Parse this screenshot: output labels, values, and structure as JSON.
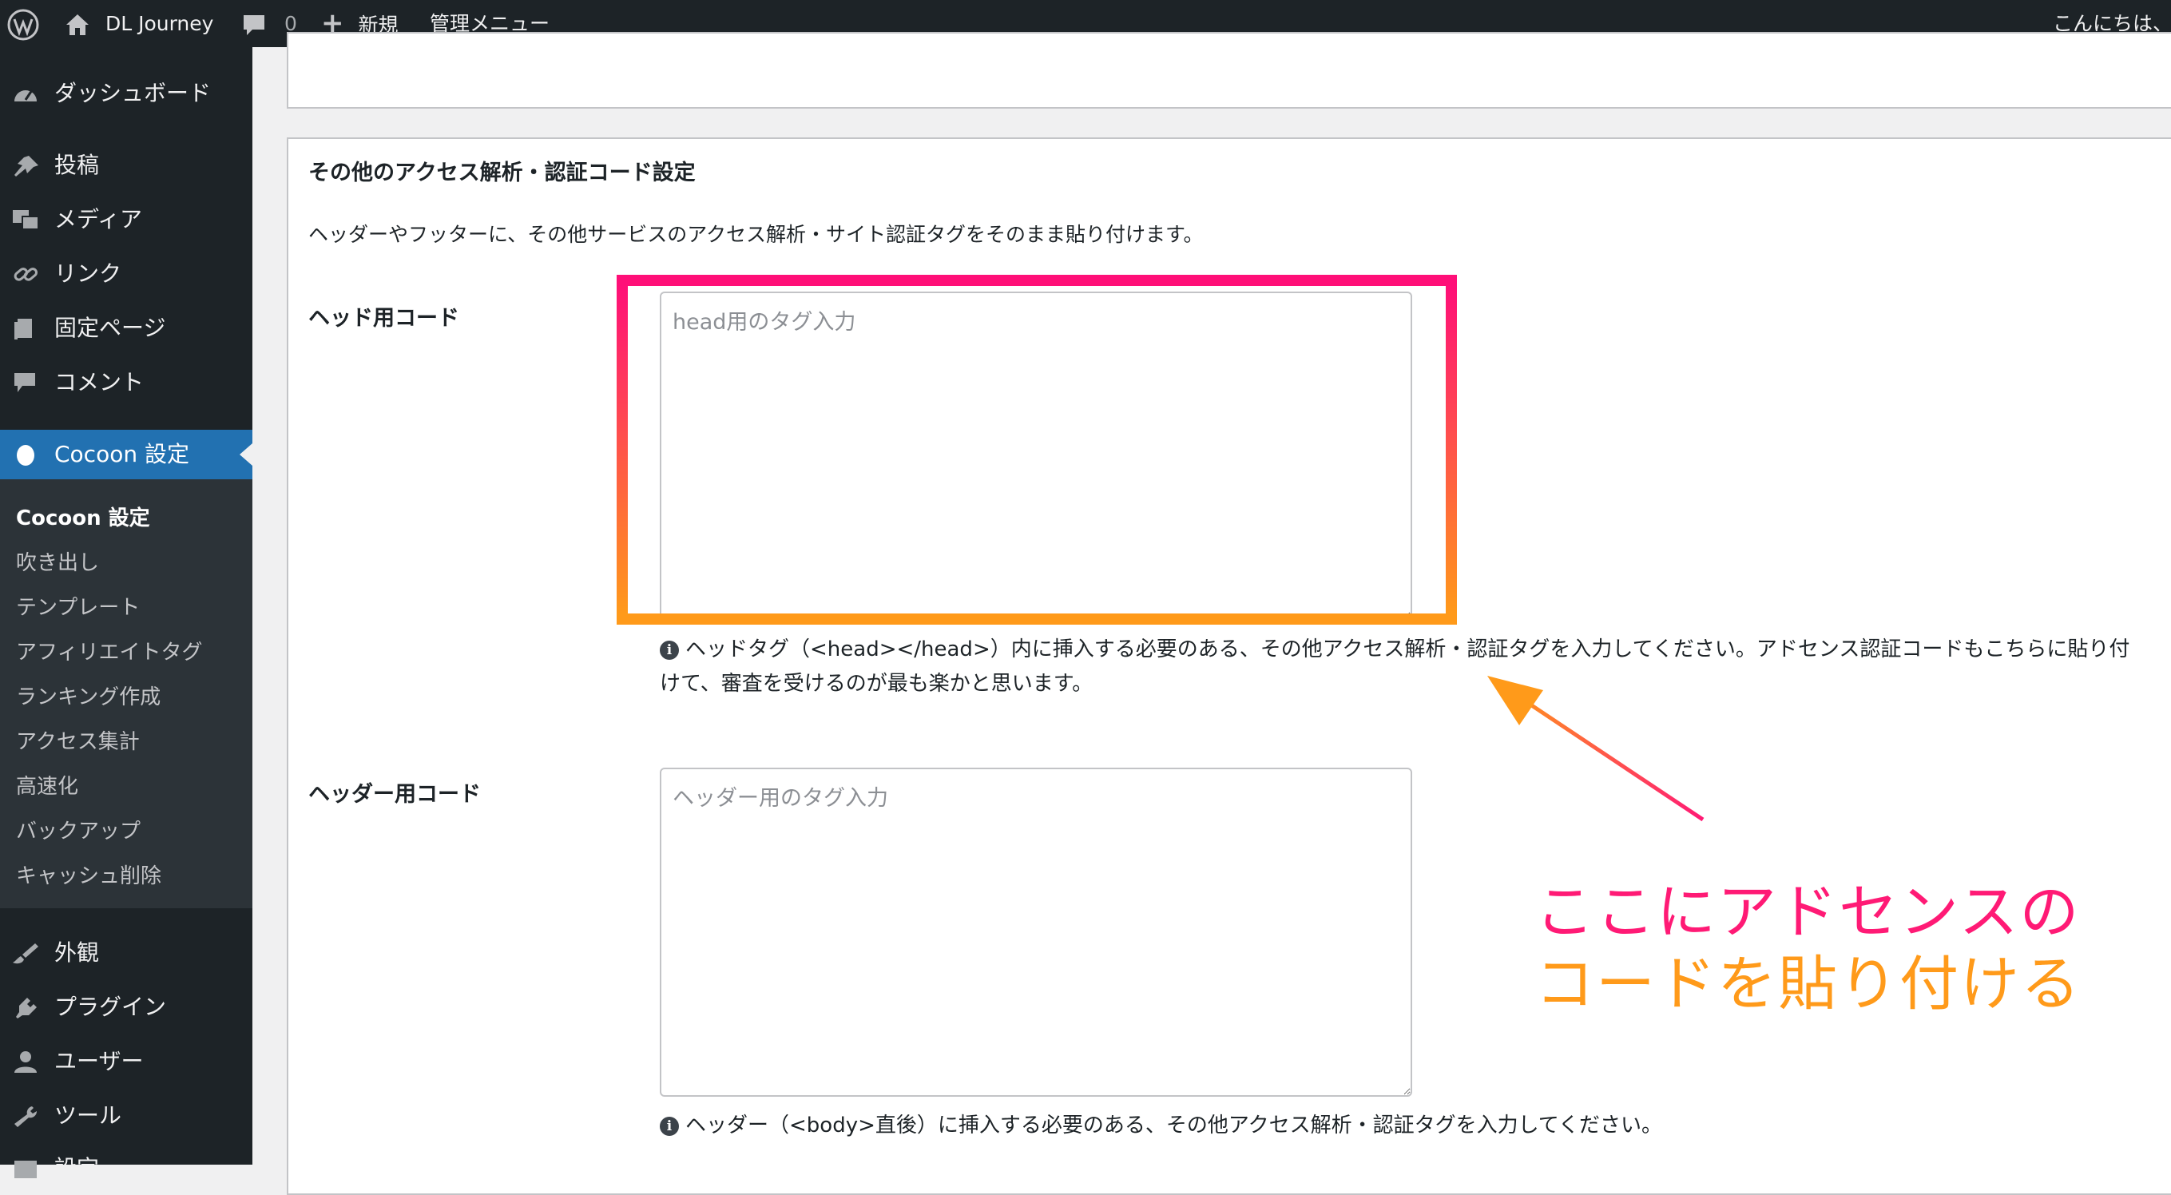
{
  "adminbar": {
    "site_name": "DL Journey",
    "comments_count": "0",
    "new_label": "新規",
    "admin_menu_label": "管理メニュー",
    "greeting": "こんにちは、"
  },
  "sidebar": {
    "items": [
      {
        "label": "ダッシュボード",
        "icon": "dashboard-icon"
      },
      {
        "label": "投稿",
        "icon": "pin-icon"
      },
      {
        "label": "メディア",
        "icon": "media-icon"
      },
      {
        "label": "リンク",
        "icon": "link-icon"
      },
      {
        "label": "固定ページ",
        "icon": "page-icon"
      },
      {
        "label": "コメント",
        "icon": "comment-icon"
      },
      {
        "label": "Cocoon 設定",
        "icon": "cocoon-icon"
      },
      {
        "label": "外観",
        "icon": "brush-icon"
      },
      {
        "label": "プラグイン",
        "icon": "plugin-icon"
      },
      {
        "label": "ユーザー",
        "icon": "user-icon"
      },
      {
        "label": "ツール",
        "icon": "wrench-icon"
      },
      {
        "label": "設定",
        "icon": "settings-icon"
      }
    ],
    "submenu": [
      "Cocoon 設定",
      "吹き出し",
      "テンプレート",
      "アフィリエイトタグ",
      "ランキング作成",
      "アクセス集計",
      "高速化",
      "バックアップ",
      "キャッシュ削除"
    ]
  },
  "section": {
    "title": "その他のアクセス解析・認証コード設定",
    "description": "ヘッダーやフッターに、その他サービスのアクセス解析・サイト認証タグをそのまま貼り付けます。",
    "head": {
      "label": "ヘッド用コード",
      "placeholder": "head用のタグ入力",
      "value": "",
      "help_line1": "ヘッドタグ（<head></head>）内に挿入する必要のある、その他アクセス解析・認証タグを入力してください。アドセンス認証コードもこちらに貼り付",
      "help_line2": "けて、審査を受けるのが最も楽かと思います。"
    },
    "header": {
      "label": "ヘッダー用コード",
      "placeholder": "ヘッダー用のタグ入力",
      "value": "",
      "help": "ヘッダー（<body>直後）に挿入する必要のある、その他アクセス解析・認証タグを入力してください。"
    }
  },
  "annotation": {
    "line1": "ここにアドセンスの",
    "line2": "コードを貼り付ける",
    "color1": "#ff1a75",
    "color2": "#ff9a1a"
  },
  "colors": {
    "adminbar_bg": "#1d2327",
    "sidebar_bg": "#1d2327",
    "submenu_bg": "#2c3338",
    "active_bg": "#2271b1"
  }
}
